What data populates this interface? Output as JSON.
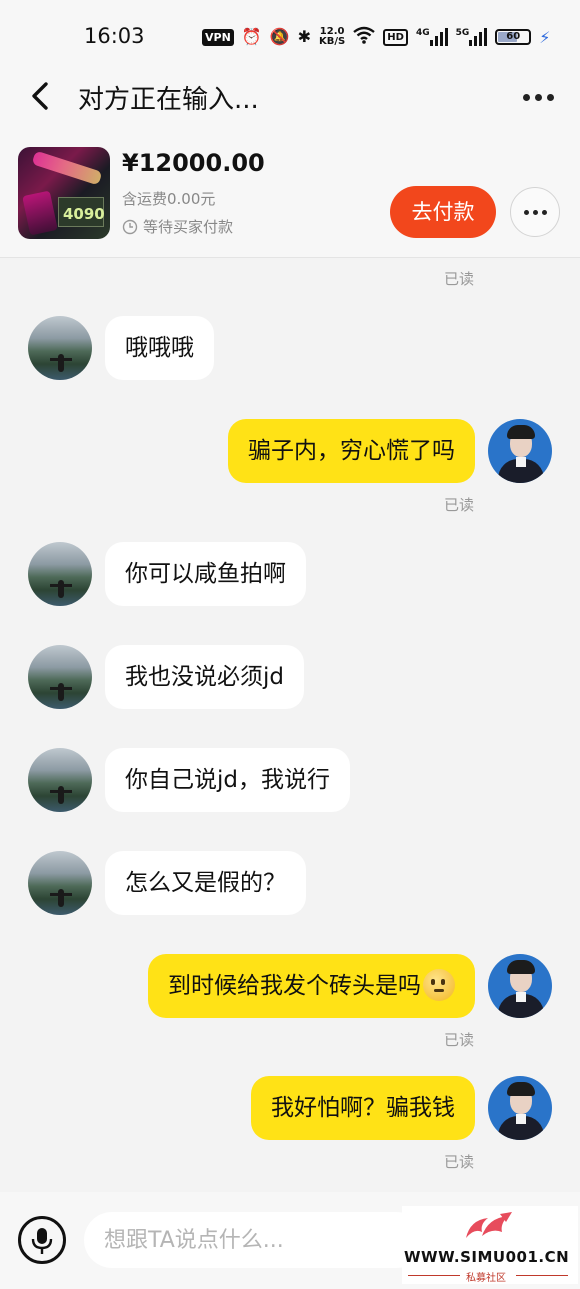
{
  "status_bar": {
    "time": "16:03",
    "vpn": "VPN",
    "net_speed_value": "12.0",
    "net_speed_unit": "KB/S",
    "hd": "HD",
    "signal1_label": "4G",
    "signal2_label": "5G",
    "battery": "60",
    "icons": [
      "alarm-icon",
      "mute-icon",
      "bluetooth-icon",
      "wifi-icon",
      "charging-icon"
    ]
  },
  "header": {
    "title": "对方正在输入..."
  },
  "product": {
    "price": "¥12000.00",
    "shipping": "含运费0.00元",
    "status": "等待买家付款",
    "pay_button": "去付款",
    "thumb_text": "4090"
  },
  "messages": [
    {
      "from": "other",
      "text": "哦哦哦"
    },
    {
      "from": "me",
      "text": "骗子内，穷心慌了吗",
      "read": "已读"
    },
    {
      "from": "other",
      "text": "你可以咸鱼拍啊"
    },
    {
      "from": "other",
      "text": "我也没说必须jd"
    },
    {
      "from": "other",
      "text": "你自己说jd，我说行"
    },
    {
      "from": "other",
      "text": "怎么又是假的？"
    },
    {
      "from": "me",
      "text": "到时候给我发个砖头是吗",
      "read": "已读",
      "emoji": "smiling-face-emoji"
    },
    {
      "from": "me",
      "text": "我好怕啊？骗我钱",
      "read": "已读"
    }
  ],
  "top_read_label": "已读",
  "input": {
    "placeholder": "想跟TA说点什么..."
  },
  "watermark": {
    "url": "WWW.SIMU001.CN",
    "name": "私募社区"
  },
  "colors": {
    "accent": "#f2471c",
    "my_bubble": "#ffe216",
    "other_bubble": "#ffffff",
    "background": "#f3f3f3"
  }
}
